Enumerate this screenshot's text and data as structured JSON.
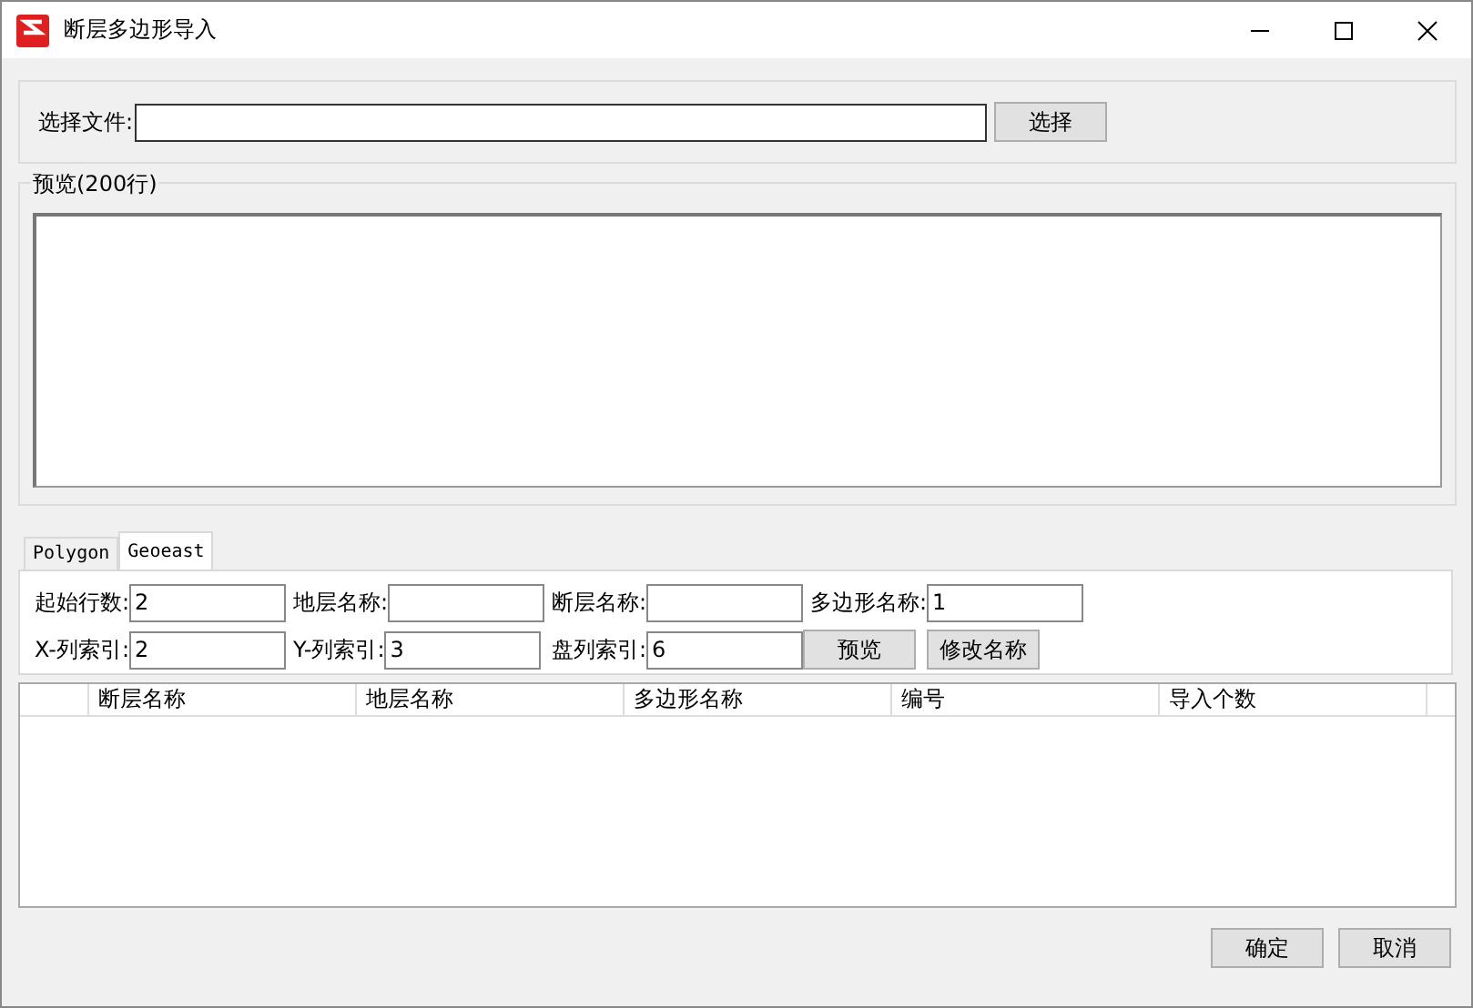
{
  "window": {
    "title": "断层多边形导入"
  },
  "file": {
    "label": "选择文件:",
    "button": "选择"
  },
  "preview": {
    "title": "预览(200行)"
  },
  "tabs": [
    {
      "label": "Polygon",
      "selected": false
    },
    {
      "label": "Geoeast",
      "selected": true
    }
  ],
  "params_row1": [
    {
      "label": "起始行数:",
      "value": "2"
    },
    {
      "label": "地层名称:"
    },
    {
      "label": "断层名称:"
    },
    {
      "label": "多边形名称:",
      "value": "1"
    }
  ],
  "params_row2": [
    {
      "label": "X-列索引:",
      "value": "2"
    },
    {
      "label": "Y-列索引:",
      "value": "3"
    },
    {
      "label": "盘列索引:",
      "value": "6"
    }
  ],
  "panel_buttons": [
    "预览",
    "修改名称"
  ],
  "table": {
    "columns": [
      "断层名称",
      "地层名称",
      "多边形名称",
      "编号",
      "导入个数"
    ]
  },
  "buttons": [
    "确定",
    "取消"
  ]
}
